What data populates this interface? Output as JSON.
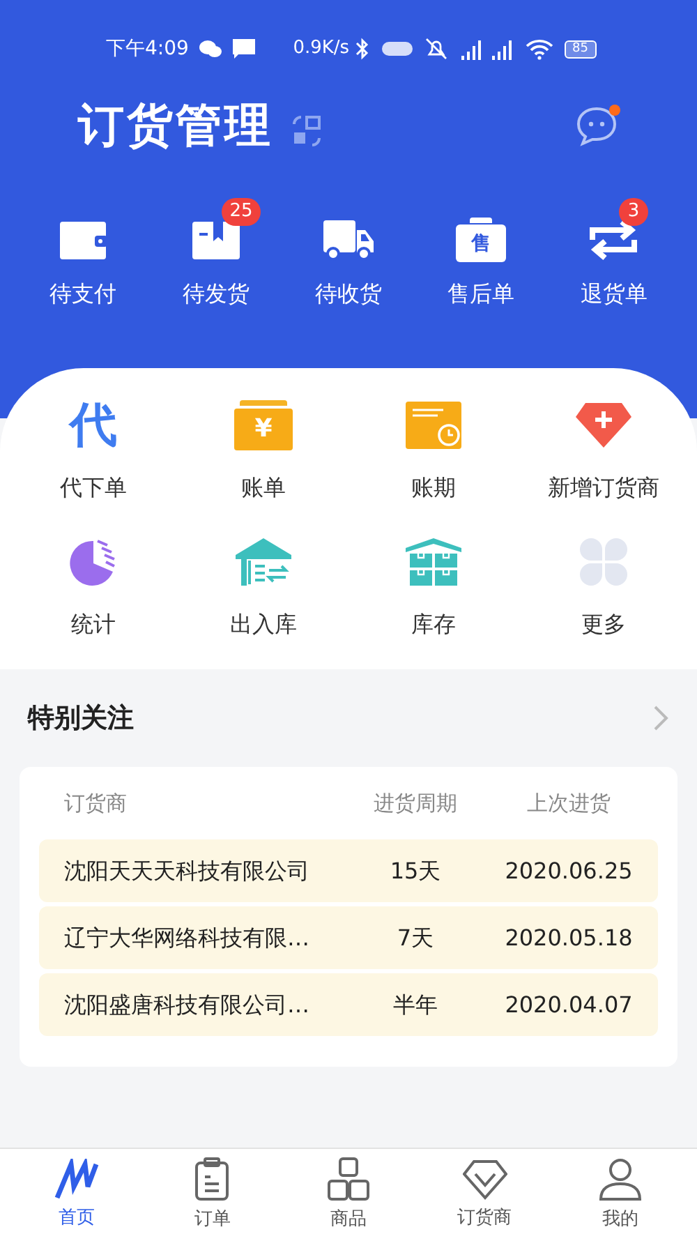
{
  "status_bar": {
    "time": "下午4:09",
    "speed": "0.9K/s",
    "battery": "85"
  },
  "header": {
    "title": "订货管理",
    "message_unread": true
  },
  "order_shortcuts": [
    {
      "kind": "wallet",
      "label": "待支付"
    },
    {
      "kind": "box",
      "label": "待发货",
      "badge": "25"
    },
    {
      "kind": "truck",
      "label": "待收货"
    },
    {
      "kind": "case",
      "label": "售后单",
      "icon_text": "售"
    },
    {
      "kind": "return",
      "label": "退货单",
      "badge": "3"
    }
  ],
  "functions": [
    {
      "kind": "glyph",
      "label": "代下单",
      "icon_text": "代"
    },
    {
      "kind": "bill",
      "label": "账单",
      "icon_text": "¥"
    },
    {
      "kind": "term",
      "label": "账期"
    },
    {
      "kind": "gem",
      "label": "新增订货商"
    },
    {
      "kind": "pie",
      "label": "统计"
    },
    {
      "kind": "warehouse",
      "label": "出入库"
    },
    {
      "kind": "stock",
      "label": "库存"
    },
    {
      "kind": "more",
      "label": "更多"
    }
  ],
  "watch": {
    "title": "特别关注",
    "columns": [
      "订货商",
      "进货周期",
      "上次进货"
    ],
    "rows": [
      [
        "沈阳天天天科技有限公司",
        "15天",
        "2020.06.25"
      ],
      [
        "辽宁大华网络科技有限…",
        "7天",
        "2020.05.18"
      ],
      [
        "沈阳盛唐科技有限公司…",
        "半年",
        "2020.04.07"
      ]
    ]
  },
  "tab_bar": [
    {
      "kind": "home",
      "label": "首页",
      "selected": true
    },
    {
      "kind": "clipboard",
      "label": "订单",
      "selected": false
    },
    {
      "kind": "boxes",
      "label": "商品",
      "selected": false
    },
    {
      "kind": "diamond",
      "label": "订货商",
      "selected": false
    },
    {
      "kind": "person",
      "label": "我的",
      "selected": false
    }
  ]
}
